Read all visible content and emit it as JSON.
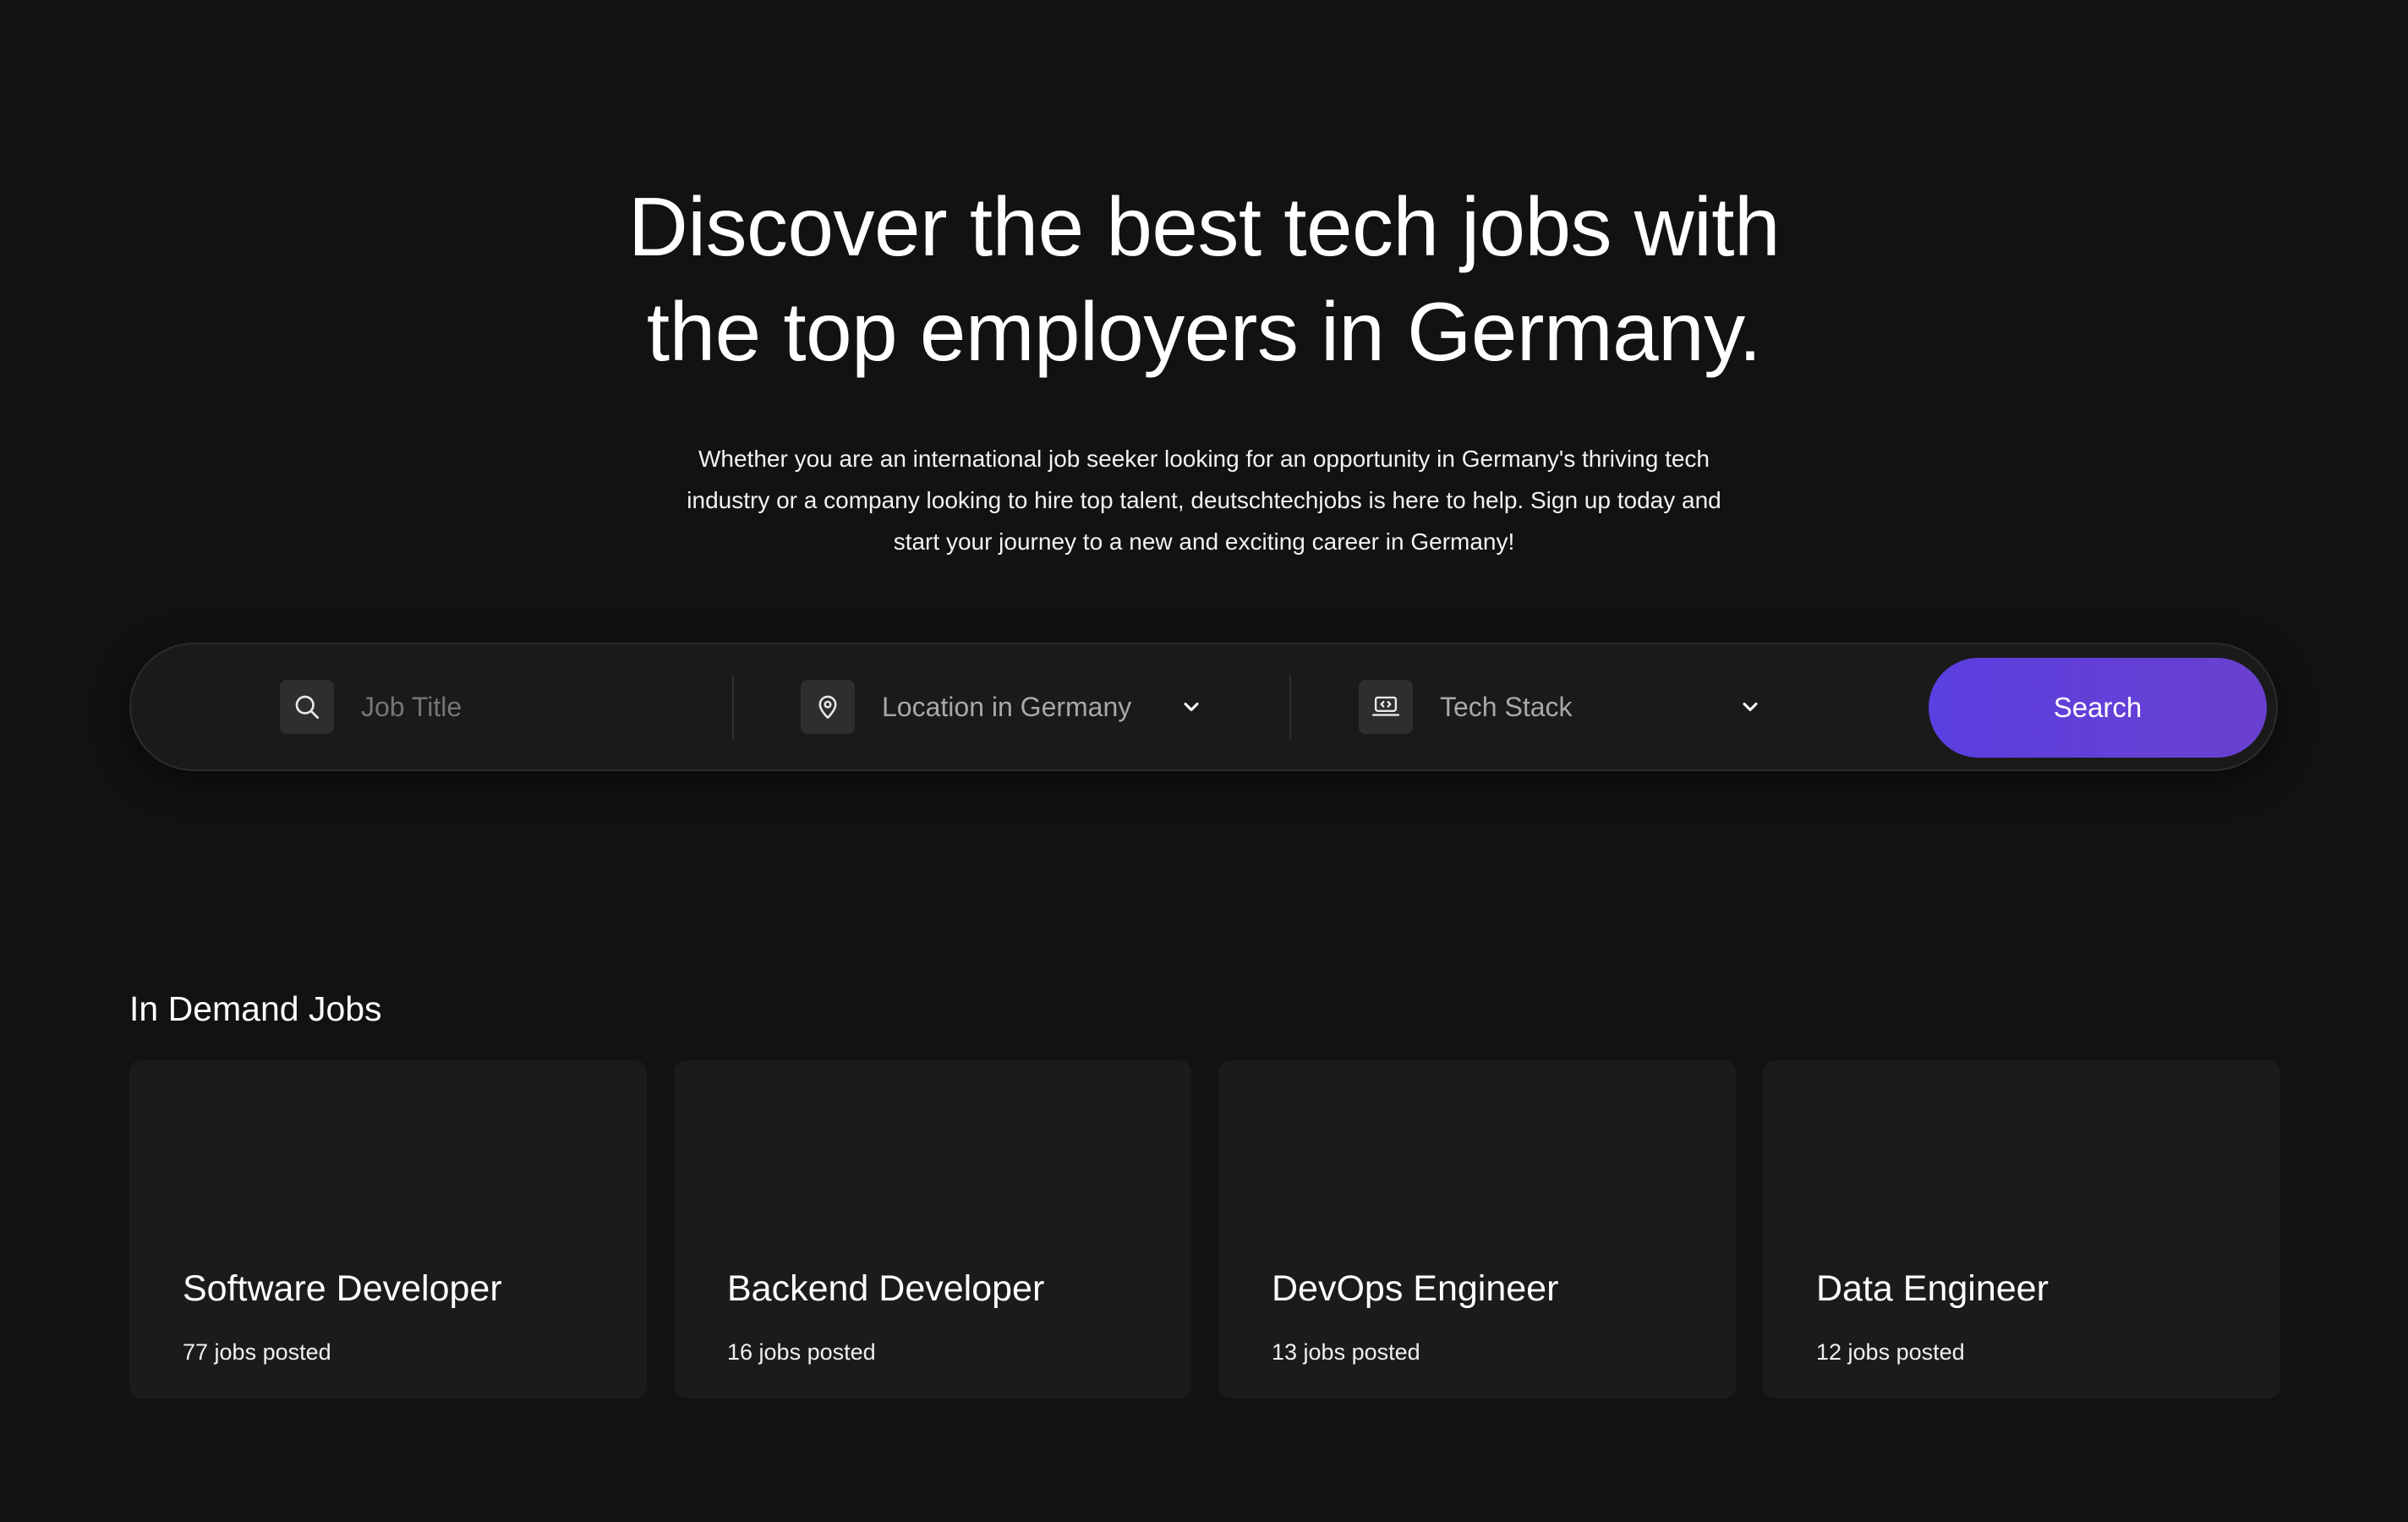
{
  "hero": {
    "title_line1": "Discover the best tech jobs with",
    "title_line2": "the top employers in Germany.",
    "subtitle_line1": "Whether you are an international job seeker looking for an opportunity in Germany's thriving tech",
    "subtitle_line2": "industry or a company looking to hire top talent, deutschtechjobs is here to help. Sign up today and",
    "subtitle_line3": "start your journey to a new and exciting career in Germany!"
  },
  "search": {
    "job_title_placeholder": "Job Title",
    "location_label": "Location in Germany",
    "tech_stack_label": "Tech Stack",
    "button_label": "Search",
    "icons": {
      "job_title": "search-icon",
      "location": "map-pin-icon",
      "tech_stack": "laptop-code-icon",
      "dropdown": "chevron-down-icon"
    }
  },
  "in_demand": {
    "title": "In Demand Jobs",
    "cards": [
      {
        "title": "Software Developer",
        "count": "77 jobs posted"
      },
      {
        "title": "Backend Developer",
        "count": "16 jobs posted"
      },
      {
        "title": "DevOps Engineer",
        "count": "13 jobs posted"
      },
      {
        "title": "Data Engineer",
        "count": "12 jobs posted"
      }
    ]
  },
  "colors": {
    "background": "#121212",
    "card_background": "#1b1b1b",
    "accent_start": "#5b3fe0",
    "accent_end": "#6a40cf"
  }
}
